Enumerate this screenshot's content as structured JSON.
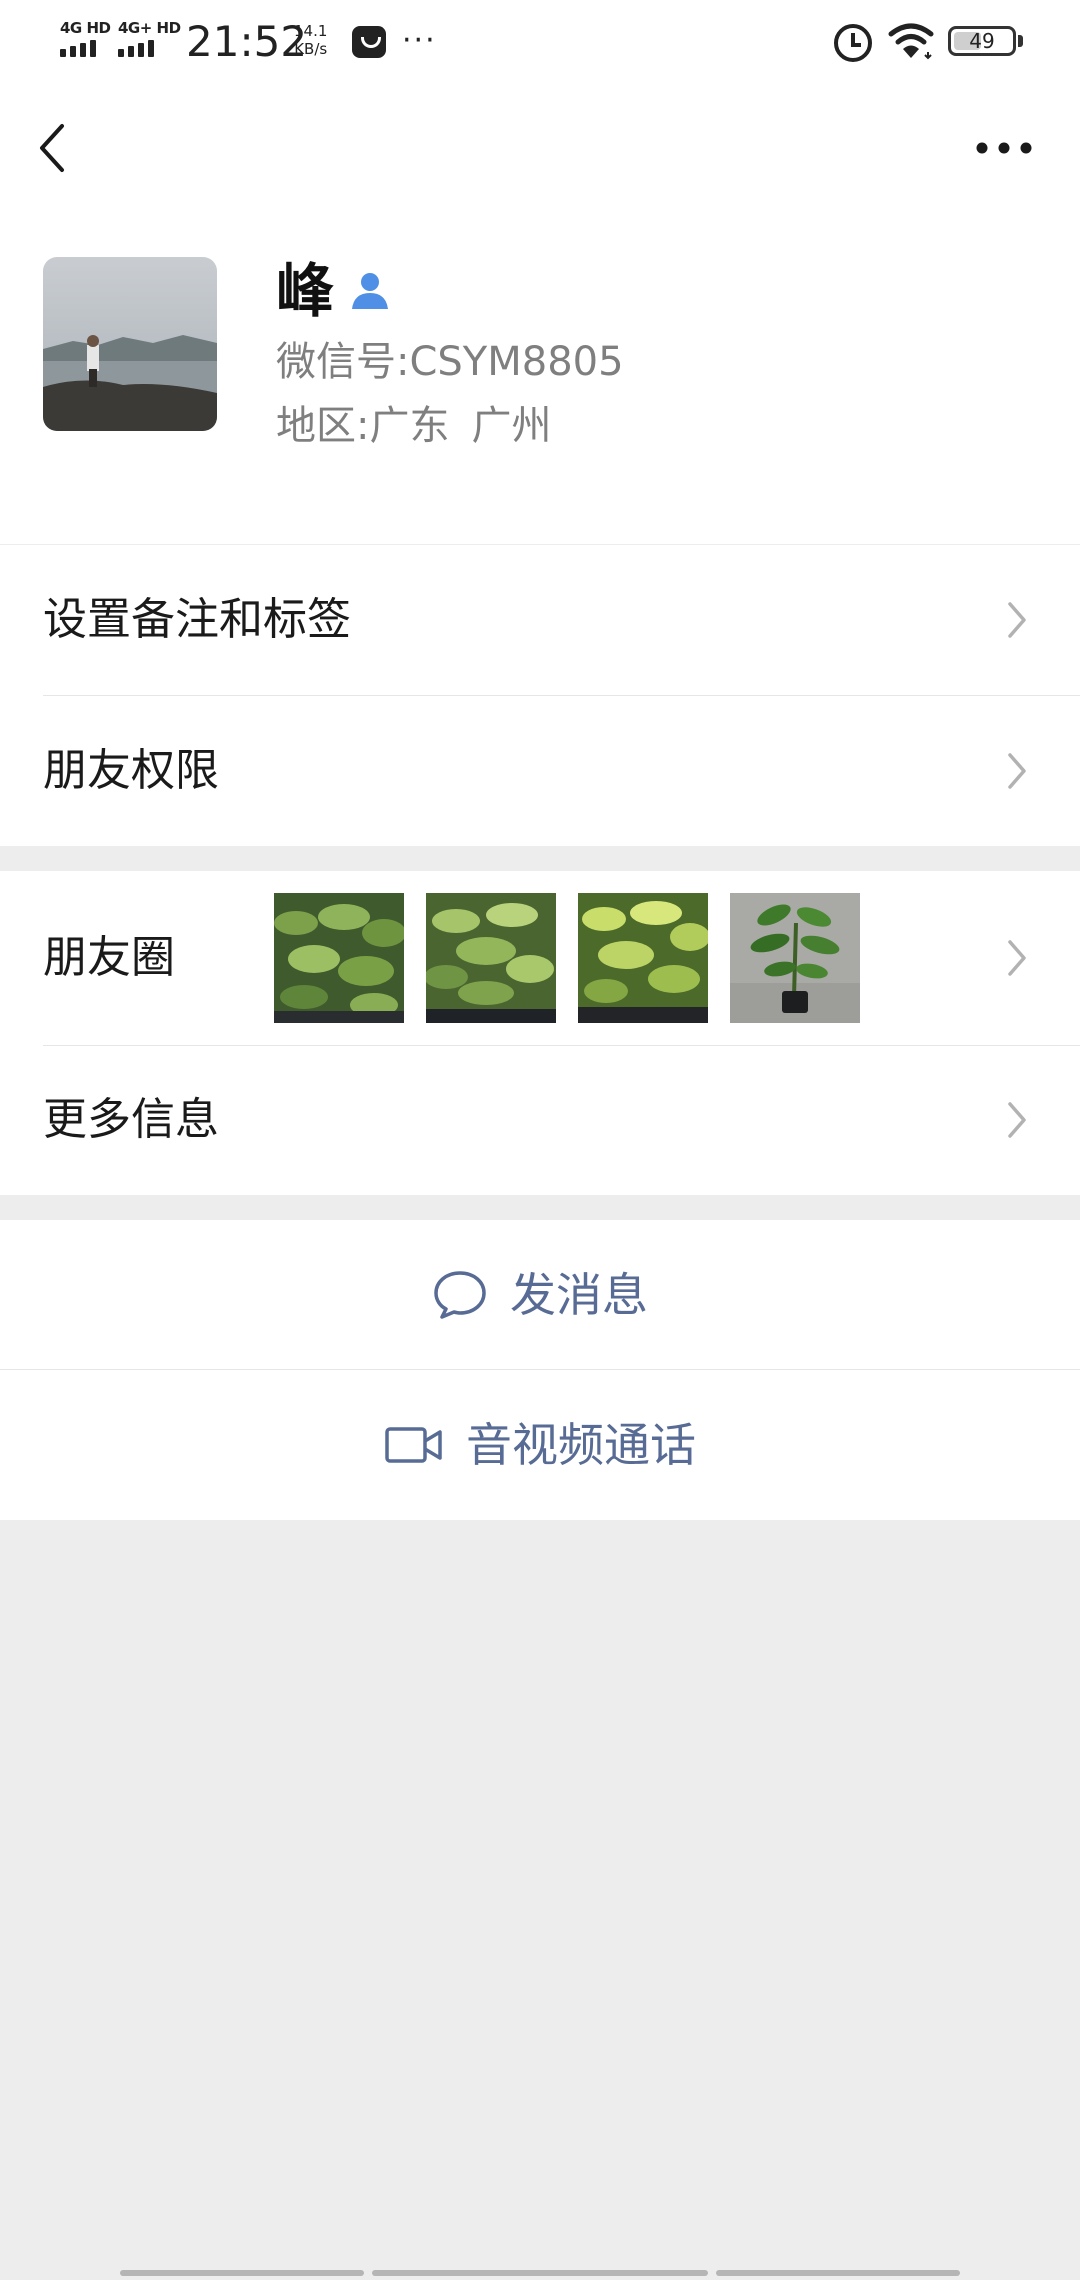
{
  "status_bar": {
    "sim1": "4G HD",
    "sim2": "4G+ HD",
    "time": "21:52",
    "speed_value": "14.1",
    "speed_unit": "KB/s",
    "more": "···",
    "battery": "49",
    "battery_level": 0.49
  },
  "nav": {
    "back_icon": "chevron-left-icon",
    "more_icon": "ellipsis-icon"
  },
  "profile": {
    "name": "峰",
    "wechat_id_label": "微信号: ",
    "wechat_id_value": "CSYM8805",
    "region_label": "地区: ",
    "region_province": "广东",
    "region_city": "广州"
  },
  "menu": {
    "remark_label": "设置备注和标签",
    "permissions_label": "朋友权限",
    "moments_label": "朋友圈",
    "more_info_label": "更多信息"
  },
  "actions": {
    "message_label": "发消息",
    "call_label": "音视频通话"
  },
  "colors": {
    "link_blue": "#576b95",
    "background": "#ededed",
    "secondary_text": "#7f7f7f"
  }
}
